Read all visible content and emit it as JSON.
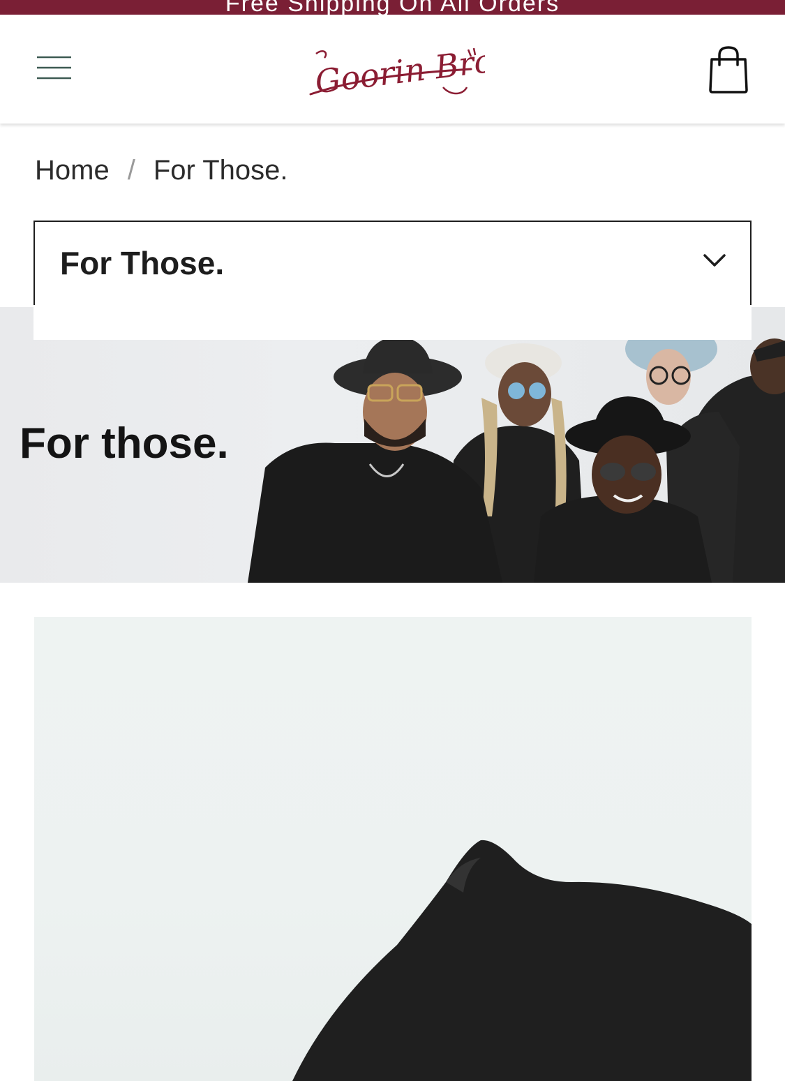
{
  "promo": {
    "text": "Free Shipping On All Orders",
    "background": "#7a1f35"
  },
  "header": {
    "menu_icon": "hamburger-menu-icon",
    "logo_text": "Goorin Bros",
    "cart_icon": "shopping-bag-icon",
    "brand_color": "#8b1d33"
  },
  "breadcrumb": {
    "home": "Home",
    "separator": "/",
    "current": "For Those."
  },
  "collection_select": {
    "value": "For Those.",
    "icon": "chevron-down-icon"
  },
  "hero": {
    "heading": "For those."
  }
}
